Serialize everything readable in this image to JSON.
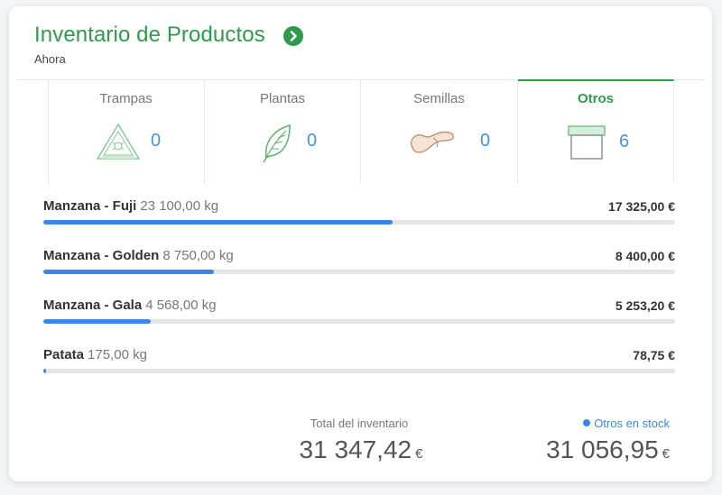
{
  "header": {
    "title": "Inventario de Productos",
    "subtitle": "Ahora",
    "arrow_icon": "chevron-right-circle-icon"
  },
  "tabs": [
    {
      "label": "Trampas",
      "count": "0",
      "icon": "trap-triangle-icon",
      "active": false
    },
    {
      "label": "Plantas",
      "count": "0",
      "icon": "leaf-icon",
      "active": false
    },
    {
      "label": "Semillas",
      "count": "0",
      "icon": "seed-icon",
      "active": false
    },
    {
      "label": "Otros",
      "count": "6",
      "icon": "box-icon",
      "active": true
    }
  ],
  "rows": [
    {
      "name": "Manzana - Fuji",
      "qty": "23 100,00 kg",
      "value": "17 325,00 €",
      "fill_percent": 55.3
    },
    {
      "name": "Manzana - Golden",
      "qty": "8 750,00 kg",
      "value": "8 400,00 €",
      "fill_percent": 27
    },
    {
      "name": "Manzana - Gala",
      "qty": "4 568,00 kg",
      "value": "5 253,20 €",
      "fill_percent": 17
    },
    {
      "name": "Patata",
      "qty": "175,00 kg",
      "value": "78,75 €",
      "fill_percent": 0.4
    }
  ],
  "totals": {
    "total_label": "Total del inventario",
    "total_value": "31 347,42",
    "total_currency": "€",
    "stock_label": "Otros en stock",
    "stock_value": "31 056,95",
    "stock_currency": "€"
  },
  "colors": {
    "brand_green": "#2e9a4b",
    "accent_blue": "#3b86ea"
  }
}
